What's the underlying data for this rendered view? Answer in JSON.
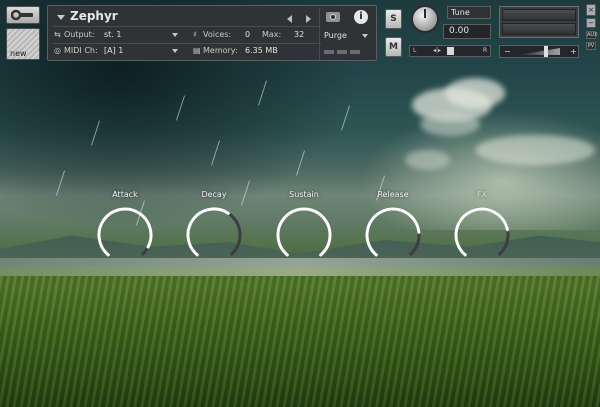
{
  "instrument": {
    "name": "Zephyr",
    "output_label": "Output:",
    "output_value": "st. 1",
    "voices_label": "Voices:",
    "voices_value": "0",
    "max_label": "Max:",
    "max_value": "32",
    "midi_label": "MIDI Ch:",
    "midi_value": "[A]  1",
    "memory_label": "Memory:",
    "memory_value": "6.35 MB",
    "purge_label": "Purge"
  },
  "header_buttons": {
    "new_label": "new",
    "solo_label": "S",
    "mute_label": "M"
  },
  "tune": {
    "label": "Tune",
    "value": "0.00"
  },
  "pan": {
    "left": "L",
    "center": "◂|▸",
    "right": "R"
  },
  "volume": {
    "minus": "−",
    "plus": "+"
  },
  "window_buttons": {
    "close": "×",
    "minimize": "−",
    "aux": "AUX",
    "pv": "PV"
  },
  "knobs": [
    {
      "label": "Attack",
      "level": 0.92,
      "dim": false
    },
    {
      "label": "Decay",
      "level": 0.62,
      "dim": false
    },
    {
      "label": "Sustain",
      "level": 1.0,
      "dim": false
    },
    {
      "label": "Release",
      "level": 0.8,
      "dim": false
    },
    {
      "label": "FX",
      "level": 0.78,
      "dim": true
    }
  ],
  "colors": {
    "knob_arc": "#ffffff",
    "knob_track": "#3b3f40",
    "panel_bg": "#2f3335"
  }
}
